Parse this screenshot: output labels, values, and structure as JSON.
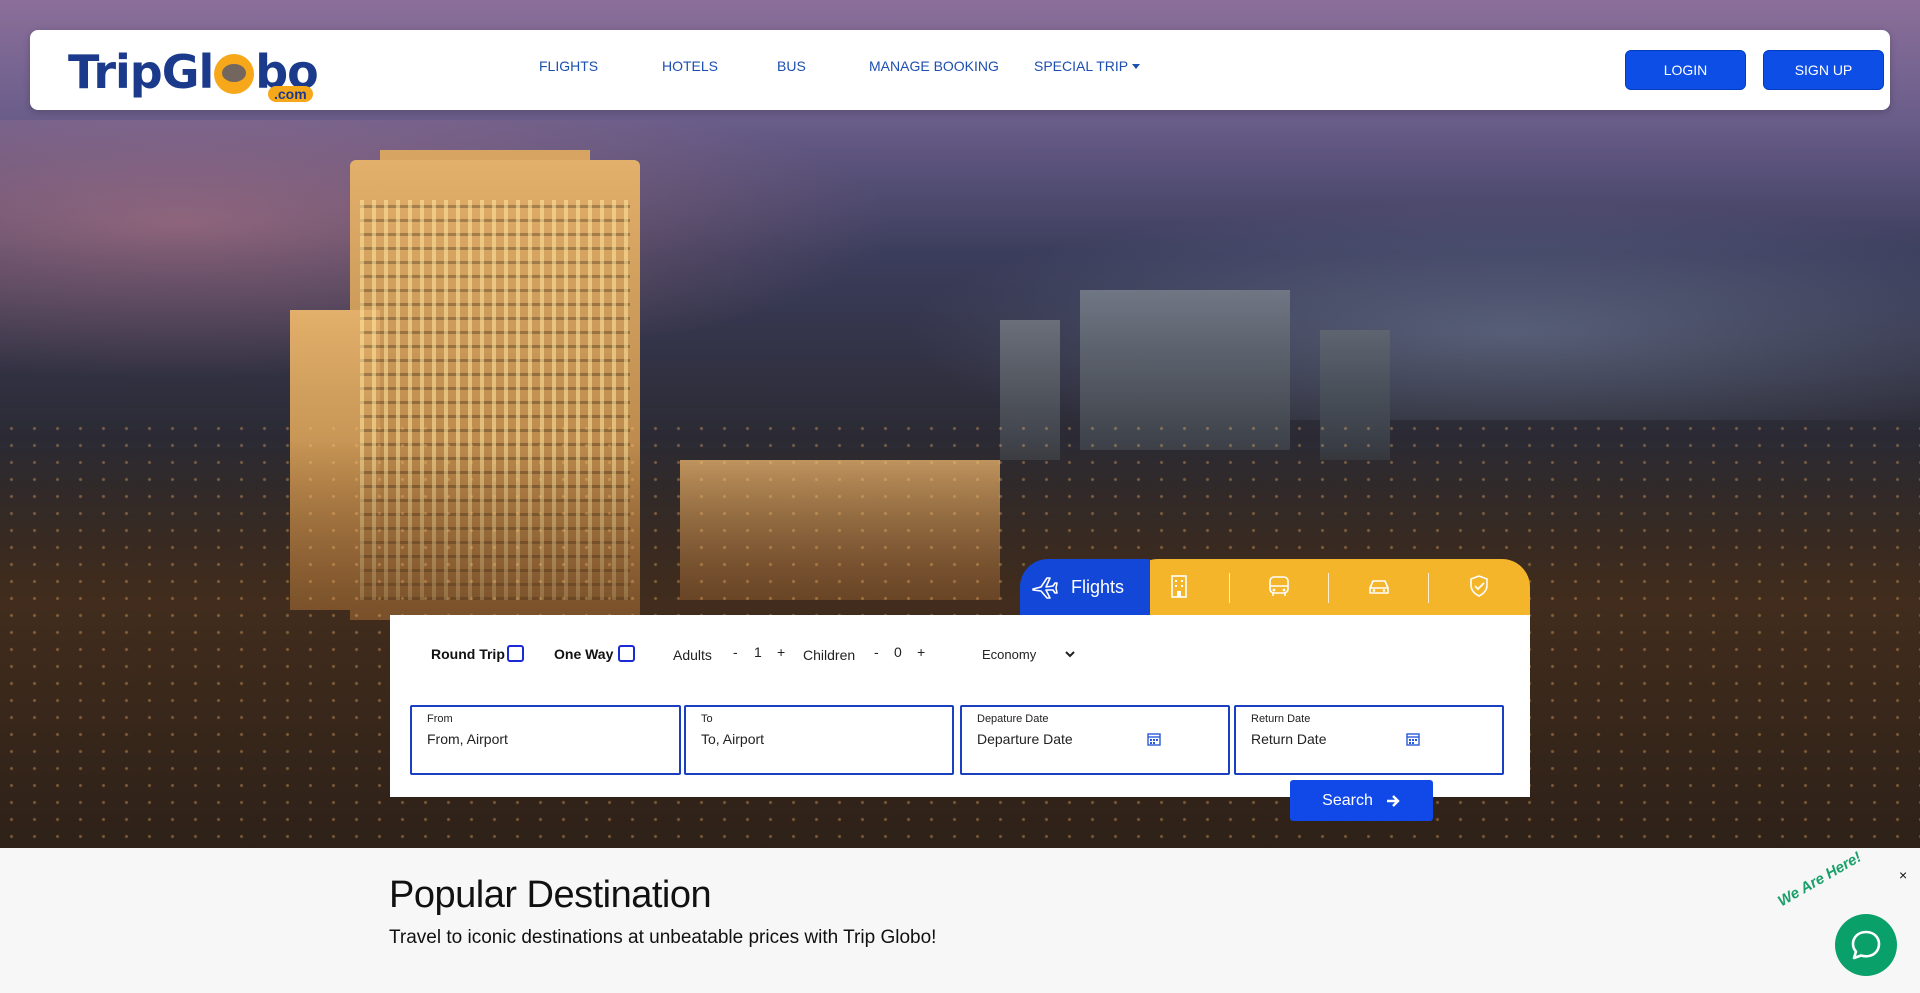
{
  "header": {
    "logo_text": "TripGlobo",
    "logo_suffix": ".com",
    "nav": [
      {
        "label": "FLIGHTS"
      },
      {
        "label": "HOTELS"
      },
      {
        "label": "BUS"
      },
      {
        "label": "MANAGE BOOKING"
      },
      {
        "label": "SPECIAL TRIP"
      }
    ],
    "login_label": "LOGIN",
    "signup_label": "SIGN UP"
  },
  "search_widget": {
    "active_tab": "Flights",
    "tab_icons": [
      "hotel-icon",
      "bus-icon",
      "car-icon",
      "insurance-shield-icon"
    ],
    "trip_types": [
      "Round Trip",
      "One Way"
    ],
    "adults_label": "Adults",
    "adults_value": "1",
    "children_label": "Children",
    "children_value": "0",
    "minus": "-",
    "plus": "+",
    "cabin_class": "Economy",
    "fields": {
      "from": {
        "label": "From",
        "value": "From, Airport"
      },
      "to": {
        "label": "To",
        "value": "To, Airport"
      },
      "departure": {
        "label": "Depature Date",
        "value": "Departure Date"
      },
      "return": {
        "label": "Return Date",
        "value": "Return Date"
      }
    },
    "search_label": "Search"
  },
  "popular": {
    "title": "Popular Destination",
    "subtitle": "Travel to iconic destinations at unbeatable prices with Trip Globo!"
  },
  "chat": {
    "tagline": "We Are Here!",
    "close": "×"
  },
  "colors": {
    "brand_blue": "#0d4fe6",
    "brand_orange": "#f5b52a",
    "chat_green": "#0aa06a"
  }
}
